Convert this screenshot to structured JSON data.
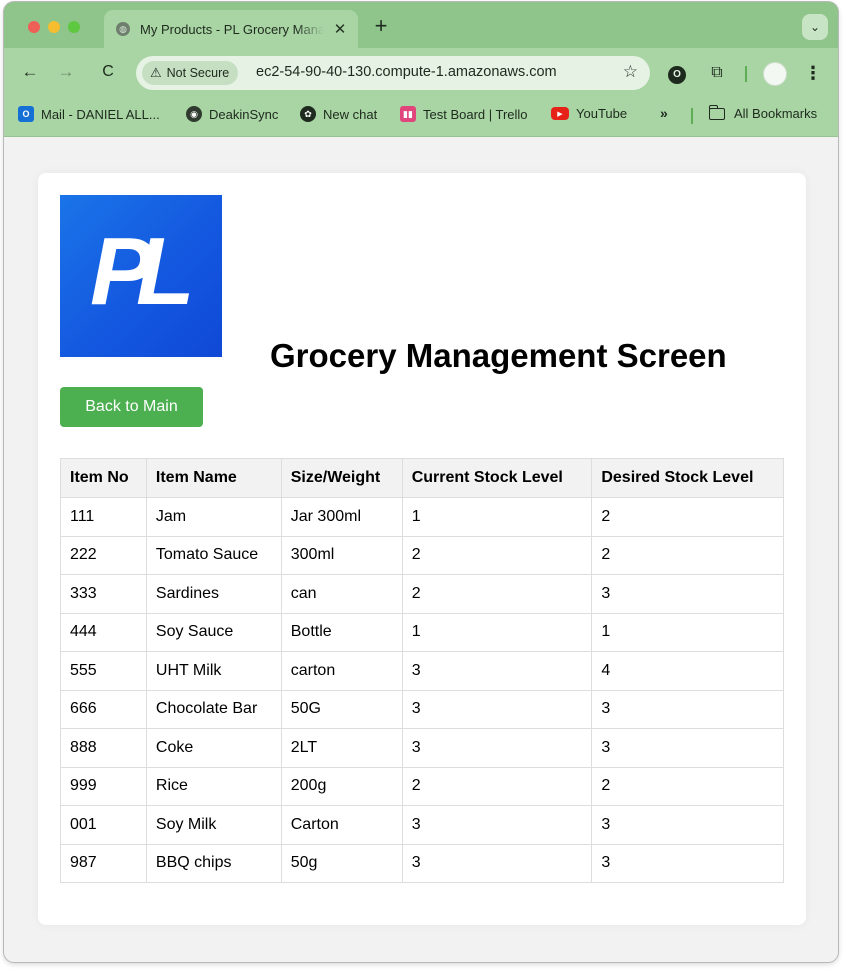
{
  "browser": {
    "tab": {
      "title": "My Products - PL Grocery Management",
      "close_glyph": "✕"
    },
    "new_tab_glyph": "+",
    "tab_search_glyph": "⌄",
    "nav": {
      "back_glyph": "←",
      "forward_glyph": "→",
      "reload_glyph": "C"
    },
    "omnibox": {
      "security_label": "Not Secure",
      "warn_glyph": "⚠",
      "url": "ec2-54-90-40-130.compute-1.amazonaws.com",
      "star_glyph": "☆"
    },
    "toolbar_glyphs": {
      "shield": "O",
      "puzzle": "⧉",
      "menu": "⋮"
    },
    "bookmarks": [
      {
        "label": "Mail - DANIEL ALL...",
        "icon": "outlook-icon",
        "icon_glyph": "O"
      },
      {
        "label": "DeakinSync",
        "icon": "deakinsync-icon",
        "icon_glyph": "◉"
      },
      {
        "label": "New chat",
        "icon": "openai-icon",
        "icon_glyph": "✿"
      },
      {
        "label": "Test Board | Trello",
        "icon": "trello-icon",
        "icon_glyph": "▮▮"
      },
      {
        "label": "YouTube",
        "icon": "youtube-icon",
        "icon_glyph": "▶"
      }
    ],
    "bookmarks_overflow_glyph": "»",
    "all_bookmarks_label": "All Bookmarks",
    "colors": {
      "frame": "#a9d5a5",
      "tabstrip": "#8fc48b",
      "omnibox": "#e6f2e4"
    }
  },
  "page": {
    "logo_text": "PL",
    "title": "Grocery Management Screen",
    "back_button_label": "Back to Main",
    "colors": {
      "button": "#4caf50",
      "logo": "#1458e0",
      "header_bg": "#f2f2f2"
    },
    "table": {
      "headers": [
        "Item No",
        "Item Name",
        "Size/Weight",
        "Current Stock Level",
        "Desired Stock Level"
      ],
      "rows": [
        [
          "111",
          "Jam",
          "Jar 300ml",
          "1",
          "2"
        ],
        [
          "222",
          "Tomato Sauce",
          "300ml",
          "2",
          "2"
        ],
        [
          "333",
          "Sardines",
          "can",
          "2",
          "3"
        ],
        [
          "444",
          "Soy Sauce",
          "Bottle",
          "1",
          "1"
        ],
        [
          "555",
          "UHT Milk",
          "carton",
          "3",
          "4"
        ],
        [
          "666",
          "Chocolate Bar",
          "50G",
          "3",
          "3"
        ],
        [
          "888",
          "Coke",
          "2LT",
          "3",
          "3"
        ],
        [
          "999",
          "Rice",
          "200g",
          "2",
          "2"
        ],
        [
          "001",
          "Soy Milk",
          "Carton",
          "3",
          "3"
        ],
        [
          "987",
          "BBQ chips",
          "50g",
          "3",
          "3"
        ]
      ]
    }
  }
}
